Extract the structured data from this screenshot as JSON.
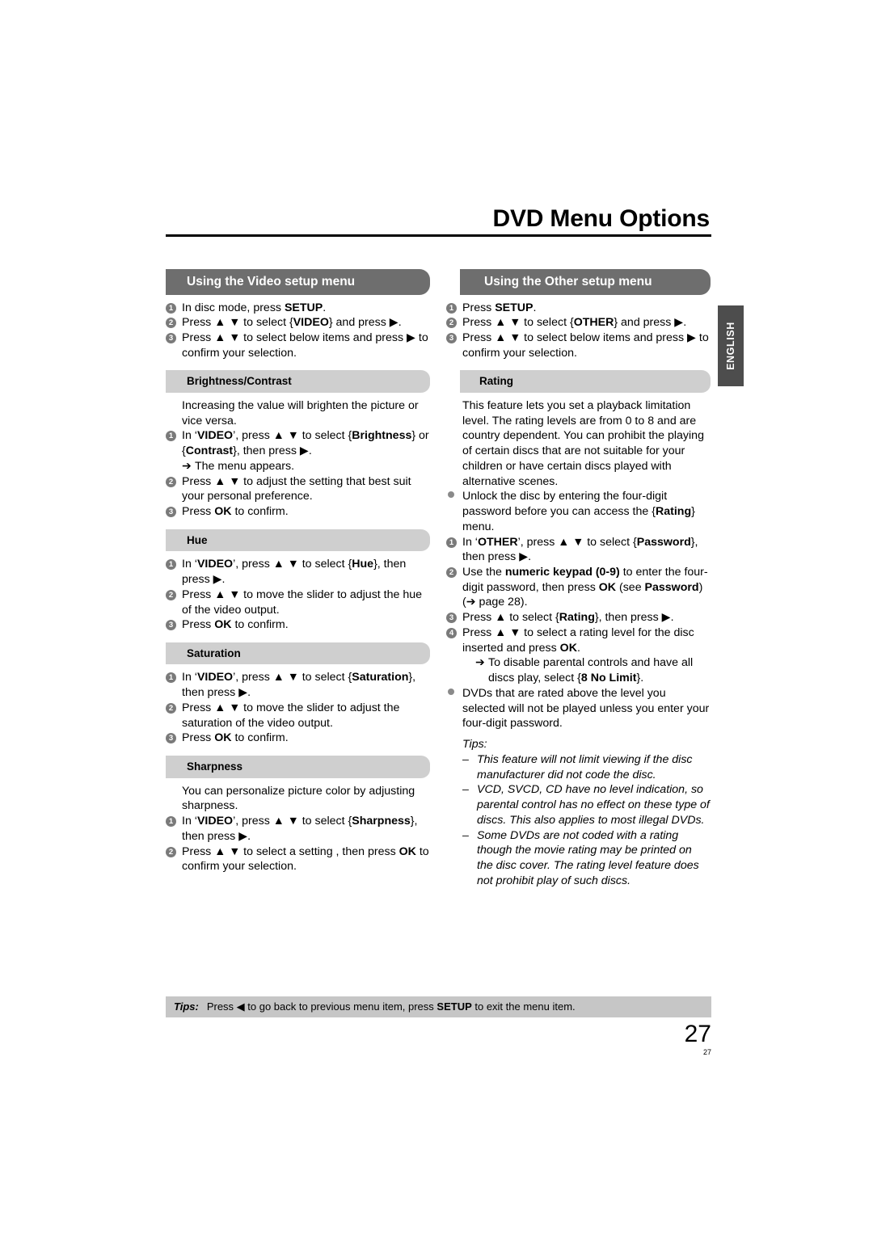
{
  "page": {
    "title": "DVD Menu Options",
    "language_tab": "ENGLISH",
    "page_number": "27",
    "page_number_small": "27"
  },
  "left_column": {
    "section_header": "Using the Video setup menu",
    "intro_steps": [
      {
        "marker": "1",
        "text_html": "In disc mode, press <b>SETUP</b>."
      },
      {
        "marker": "2",
        "text_html": "Press ▲ ▼ to select {<b>VIDEO</b>} and press ▶."
      },
      {
        "marker": "3",
        "text_html": "Press ▲ ▼ to select below items and press ▶ to confirm your selection."
      }
    ],
    "subsections": [
      {
        "heading": "Brightness/Contrast",
        "lead": "Increasing the value will brighten the picture or vice versa.",
        "steps": [
          {
            "marker": "1",
            "text_html": "In ‘<b>VIDEO</b>’, press ▲ ▼ to select {<b>Brightness</b>} or {<b>Contrast</b>}, then press ▶."
          },
          {
            "marker": "arrow",
            "text_html": "The menu appears."
          },
          {
            "marker": "2",
            "text_html": "Press ▲ ▼ to adjust the setting that best suit your personal preference."
          },
          {
            "marker": "3",
            "text_html": "Press <b>OK</b> to confirm."
          }
        ]
      },
      {
        "heading": "Hue",
        "lead": "",
        "steps": [
          {
            "marker": "1",
            "text_html": "In ‘<b>VIDEO</b>’, press ▲ ▼ to select {<b>Hue</b>}, then press ▶."
          },
          {
            "marker": "2",
            "text_html": "Press ▲ ▼ to move the slider to adjust the hue of the video output."
          },
          {
            "marker": "3",
            "text_html": "Press <b>OK</b> to confirm."
          }
        ]
      },
      {
        "heading": "Saturation",
        "lead": "",
        "steps": [
          {
            "marker": "1",
            "text_html": "In ‘<b>VIDEO</b>’, press ▲ ▼ to select {<b>Saturation</b>}, then press ▶."
          },
          {
            "marker": "2",
            "text_html": "Press ▲ ▼ to move the slider to adjust the saturation of the video output."
          },
          {
            "marker": "3",
            "text_html": "Press <b>OK</b> to confirm."
          }
        ]
      },
      {
        "heading": "Sharpness",
        "lead": "You can personalize picture color by adjusting sharpness.",
        "steps": [
          {
            "marker": "1",
            "text_html": "In ‘<b>VIDEO</b>’, press ▲ ▼ to select {<b>Sharpness</b>}, then press ▶."
          },
          {
            "marker": "2",
            "text_html": "Press ▲ ▼ to select a setting , then press <b>OK</b> to confirm your selection."
          }
        ]
      }
    ]
  },
  "right_column": {
    "section_header": "Using the Other setup menu",
    "intro_steps": [
      {
        "marker": "1",
        "text_html": "Press <b>SETUP</b>."
      },
      {
        "marker": "2",
        "text_html": "Press ▲ ▼ to select {<b>OTHER</b>} and press ▶."
      },
      {
        "marker": "3",
        "text_html": "Press ▲ ▼ to select below items and press ▶ to confirm your selection."
      }
    ],
    "subsections": [
      {
        "heading": "Rating",
        "lead": "This feature lets you set a playback limitation level. The rating levels are from 0 to 8 and are country dependent. You can prohibit the playing of certain discs that are not suitable for your children or have certain discs played with alternative scenes.",
        "steps": [
          {
            "marker": "dot",
            "text_html": "Unlock the disc by entering the four-digit password before you can access the {<b>Rating</b>} menu."
          },
          {
            "marker": "1",
            "text_html": "In ‘<b>OTHER</b>’, press ▲ ▼ to select {<b>Password</b>}, then press ▶."
          },
          {
            "marker": "2",
            "text_html": "Use the <b>numeric keypad (0-9)</b> to enter the four-digit password, then press <b>OK</b> (see <b>Password</b>) (➔ page 28)."
          },
          {
            "marker": "3",
            "text_html": "Press ▲ to select {<b>Rating</b>}, then press ▶."
          },
          {
            "marker": "4",
            "text_html": "Press ▲ ▼ to select a rating level for the disc inserted and press <b>OK</b>."
          },
          {
            "marker": "arrow-deep",
            "text_html": "To disable parental controls and have all discs play, select {<b>8 No Limit</b>}."
          },
          {
            "marker": "dot",
            "text_html": "DVDs that are rated above the level you selected will not be played unless you enter your four-digit password."
          }
        ],
        "tips_label": "Tips:",
        "tips": [
          "This feature will not limit viewing if the disc manufacturer did not code the disc.",
          "VCD, SVCD, CD have no level indication, so parental control has no effect on these type of discs. This also applies to most illegal DVDs.",
          "Some DVDs are not coded with a rating though the movie rating may be printed on the disc cover. The rating level feature does not prohibit play of such discs."
        ]
      }
    ]
  },
  "footer": {
    "label": "Tips:",
    "text_html": "Press ◀ to go back to previous menu item, press <b>SETUP</b> to exit the menu item."
  },
  "colors": {
    "section_header_bg": "#6e6e6e",
    "sub_header_bg": "#cfcfcf",
    "footer_bg": "#c6c6c6",
    "lang_tab_bg": "#4d4d4d",
    "marker_gray": "#7a7a7a"
  }
}
